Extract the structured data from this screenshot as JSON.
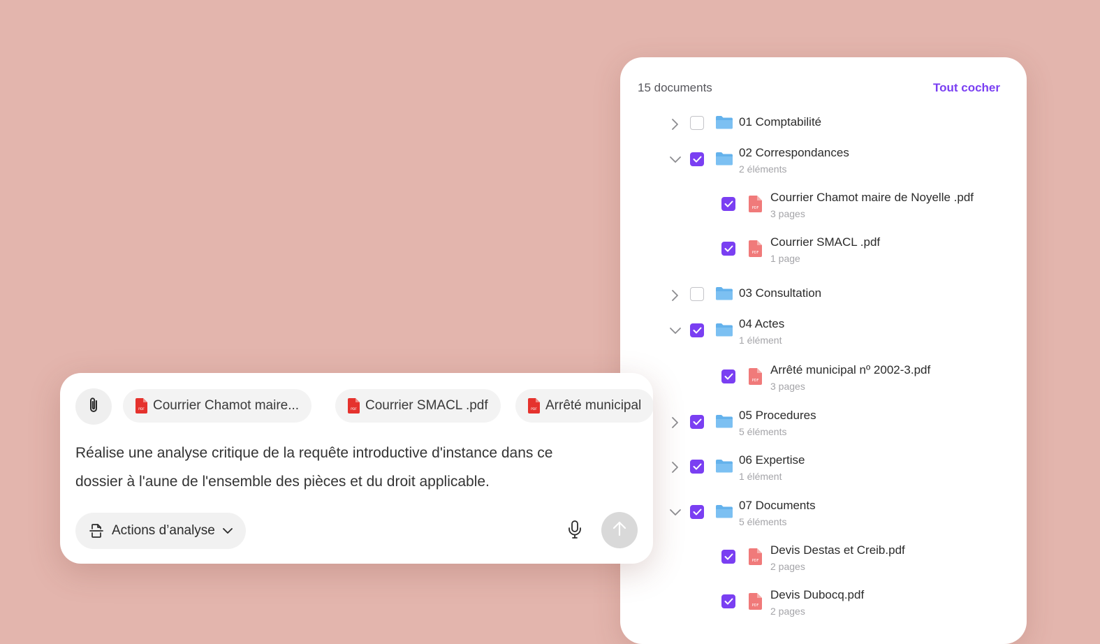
{
  "colors": {
    "background": "#e3b5ad",
    "accent": "#7a3ff2",
    "folder": "#64b2ec",
    "pdf_icon_tree": "#f07a7a",
    "pdf_icon_chip": "#e5322d"
  },
  "tree": {
    "count_label": "15 documents",
    "check_all_label": "Tout cocher",
    "rows": [
      {
        "type": "folder",
        "label": "01 Comptabilité",
        "sub": "",
        "expanded": false,
        "checked": false,
        "icon": "folder-icon"
      },
      {
        "type": "folder",
        "label": "02 Correspondances",
        "sub": "2 éléments",
        "expanded": true,
        "checked": true,
        "icon": "folder-icon"
      },
      {
        "type": "file",
        "label": "Courrier Chamot maire de Noyelle .pdf",
        "sub": "3 pages",
        "checked": true,
        "icon": "pdf-file-icon"
      },
      {
        "type": "file",
        "label": "Courrier SMACL .pdf",
        "sub": "1 page",
        "checked": true,
        "icon": "pdf-file-icon"
      },
      {
        "type": "folder",
        "label": "03 Consultation",
        "sub": "",
        "expanded": false,
        "checked": false,
        "icon": "folder-icon"
      },
      {
        "type": "folder",
        "label": "04 Actes",
        "sub": "1 élément",
        "expanded": true,
        "checked": true,
        "icon": "folder-icon"
      },
      {
        "type": "file",
        "label": "Arrêté municipal nº 2002-3.pdf",
        "sub": "3 pages",
        "checked": true,
        "icon": "pdf-file-icon"
      },
      {
        "type": "folder",
        "label": "05 Procedures",
        "sub": "5 éléments",
        "expanded": false,
        "checked": true,
        "icon": "folder-icon"
      },
      {
        "type": "folder",
        "label": "06 Expertise",
        "sub": "1 élément",
        "expanded": false,
        "checked": true,
        "icon": "folder-icon"
      },
      {
        "type": "folder",
        "label": "07 Documents",
        "sub": "5 éléments",
        "expanded": true,
        "checked": true,
        "icon": "folder-icon"
      },
      {
        "type": "file",
        "label": "Devis Destas et Creib.pdf",
        "sub": "2 pages",
        "checked": true,
        "icon": "pdf-file-icon"
      },
      {
        "type": "file",
        "label": "Devis Dubocq.pdf",
        "sub": "2 pages",
        "checked": true,
        "icon": "pdf-file-icon"
      }
    ]
  },
  "composer": {
    "attach_icon": "paperclip-icon",
    "chips": [
      {
        "label": "Courrier Chamot maire...",
        "icon": "pdf-icon"
      },
      {
        "label": "Courrier SMACL .pdf",
        "icon": "pdf-icon"
      },
      {
        "label": "Arrêté municipal",
        "icon": "pdf-icon"
      }
    ],
    "prompt_line1": "Réalise une analyse critique de la requête introductive d'instance dans ce",
    "prompt_line2": "dossier à l'aune de l'ensemble des pièces et du droit applicable.",
    "actions_label": "Actions d’analyse",
    "actions_icon": "document-scan-icon",
    "mic_icon": "microphone-icon",
    "send_icon": "arrow-up-icon"
  }
}
